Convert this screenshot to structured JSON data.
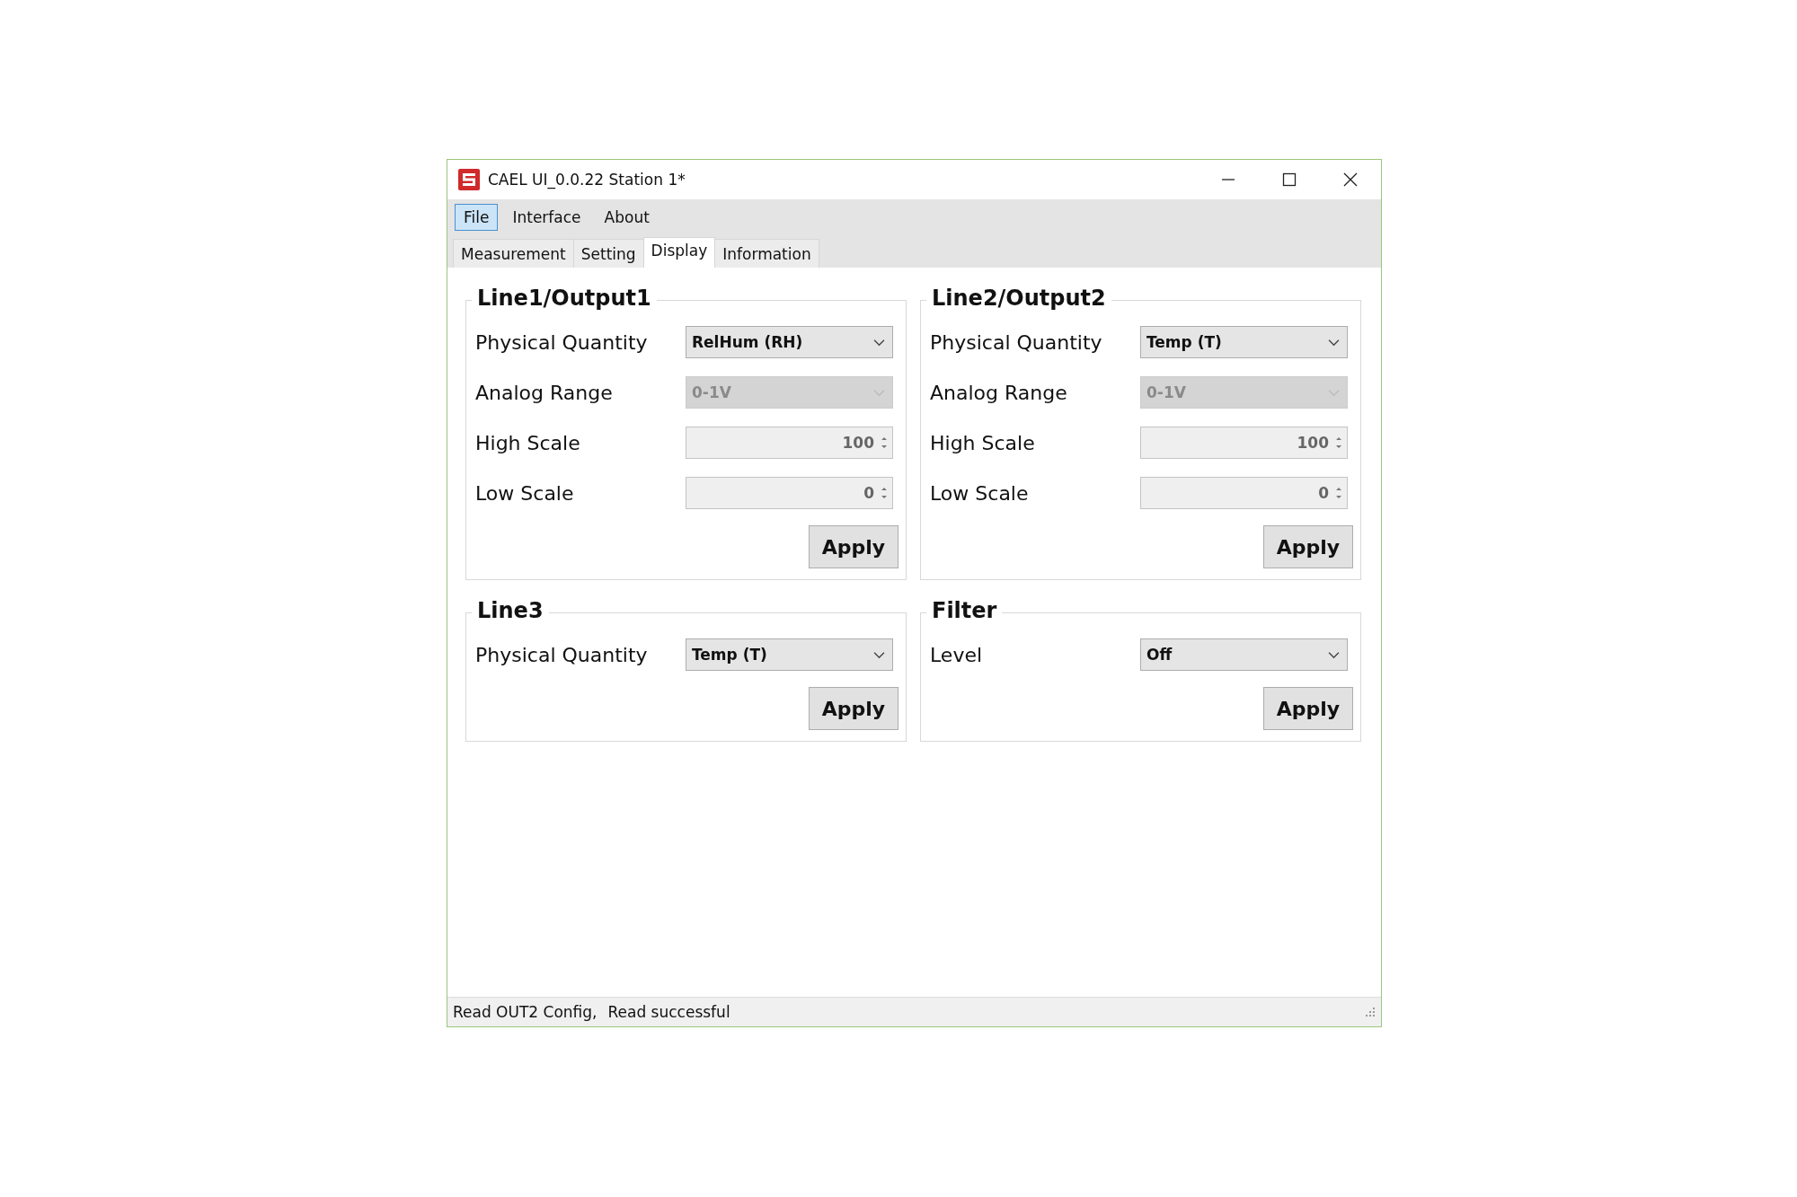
{
  "window": {
    "title": "CAEL UI_0.0.22  Station 1*"
  },
  "menu": [
    {
      "label": "File",
      "selected": true
    },
    {
      "label": "Interface",
      "selected": false
    },
    {
      "label": "About",
      "selected": false
    }
  ],
  "tabs": [
    {
      "label": "Measurement",
      "selected": false
    },
    {
      "label": "Setting",
      "selected": false
    },
    {
      "label": "Display",
      "selected": true
    },
    {
      "label": "Information",
      "selected": false
    }
  ],
  "panels": [
    {
      "title": "Line1/Output1",
      "rows": [
        {
          "kind": "combo",
          "label": "Physical Quantity",
          "value": "RelHum (RH)",
          "disabled": false
        },
        {
          "kind": "combo",
          "label": "Analog Range",
          "value": "0-1V",
          "disabled": true
        },
        {
          "kind": "spin",
          "label": "High Scale",
          "value": "100",
          "disabled": true
        },
        {
          "kind": "spin",
          "label": "Low Scale",
          "value": "0",
          "disabled": true
        }
      ],
      "button": "Apply"
    },
    {
      "title": "Line2/Output2",
      "rows": [
        {
          "kind": "combo",
          "label": "Physical Quantity",
          "value": "Temp (T)",
          "disabled": false
        },
        {
          "kind": "combo",
          "label": "Analog Range",
          "value": "0-1V",
          "disabled": true
        },
        {
          "kind": "spin",
          "label": "High Scale",
          "value": "100",
          "disabled": true
        },
        {
          "kind": "spin",
          "label": "Low Scale",
          "value": "0",
          "disabled": true
        }
      ],
      "button": "Apply"
    },
    {
      "title": "Line3",
      "rows": [
        {
          "kind": "combo",
          "label": "Physical Quantity",
          "value": "Temp (T)",
          "disabled": false
        }
      ],
      "button": "Apply"
    },
    {
      "title": "Filter",
      "rows": [
        {
          "kind": "combo",
          "label": "Level",
          "value": "Off",
          "disabled": false
        }
      ],
      "button": "Apply"
    }
  ],
  "status_bar": [
    "Read OUT2 Config,",
    "Read successful"
  ]
}
